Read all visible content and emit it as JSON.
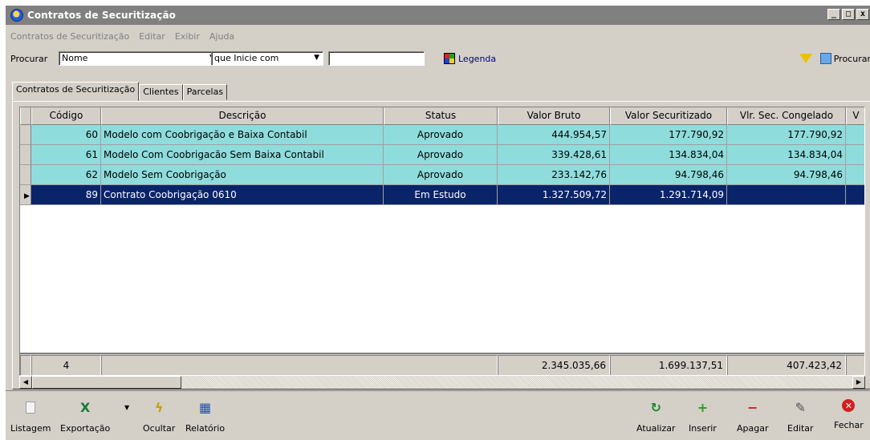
{
  "window": {
    "title": "Contratos de Securitização",
    "controls": [
      "_",
      "□",
      "x"
    ]
  },
  "menu": {
    "items": [
      {
        "label": "Contratos de Securitização",
        "accel": "C"
      },
      {
        "label": "Editar",
        "accel": "E"
      },
      {
        "label": "Exibir",
        "accel": "x"
      },
      {
        "label": "Ajuda",
        "accel": "A"
      }
    ]
  },
  "search": {
    "label": "Procurar",
    "field_value": "Nome",
    "mode_value": "que Inicie com",
    "text_value": "",
    "legend_label": "Legenda",
    "procurar_label": "Procurar"
  },
  "tabs": [
    {
      "label": "Contratos de Securitização",
      "active": true
    },
    {
      "label": "Clientes",
      "active": false
    },
    {
      "label": "Parcelas",
      "active": false
    }
  ],
  "grid": {
    "columns": [
      "Código",
      "Descrição",
      "Status",
      "Valor Bruto",
      "Valor Securitizado",
      "Vlr. Sec. Congelado",
      "V"
    ],
    "rows": [
      {
        "codigo": "60",
        "descricao": "Modelo com Coobrigação e Baixa Contabil",
        "status": "Aprovado",
        "valor_bruto": "444.954,57",
        "valor_securitizado": "177.790,92",
        "congelado": "177.790,92",
        "style": "teal"
      },
      {
        "codigo": "61",
        "descricao": "Modelo Com Coobrigacão Sem Baixa Contabil",
        "status": "Aprovado",
        "valor_bruto": "339.428,61",
        "valor_securitizado": "134.834,04",
        "congelado": "134.834,04",
        "style": "teal"
      },
      {
        "codigo": "62",
        "descricao": "Modelo Sem Coobrigação",
        "status": "Aprovado",
        "valor_bruto": "233.142,76",
        "valor_securitizado": "94.798,46",
        "congelado": "94.798,46",
        "style": "teal"
      },
      {
        "codigo": "89",
        "descricao": "Contrato Coobrigação 0610",
        "status": "Em Estudo",
        "valor_bruto": "1.327.509,72",
        "valor_securitizado": "1.291.714,09",
        "congelado": "",
        "style": "selected"
      }
    ],
    "footer": {
      "count": "4",
      "valor_bruto": "2.345.035,66",
      "valor_securitizado": "1.699.137,51",
      "congelado": "407.423,42"
    }
  },
  "toolbar": {
    "listagem": "Listagem",
    "exportacao": "Exportação",
    "ocultar": "Ocultar",
    "relatorio": "Relatório",
    "atualizar": "Atualizar",
    "inserir": "Inserir",
    "apagar": "Apagar",
    "editar": "Editar",
    "fechar": "Fechar"
  },
  "colors": {
    "teal_row": "#8fdcdc",
    "selected_row": "#0a246a",
    "title_bar": "#808080"
  }
}
